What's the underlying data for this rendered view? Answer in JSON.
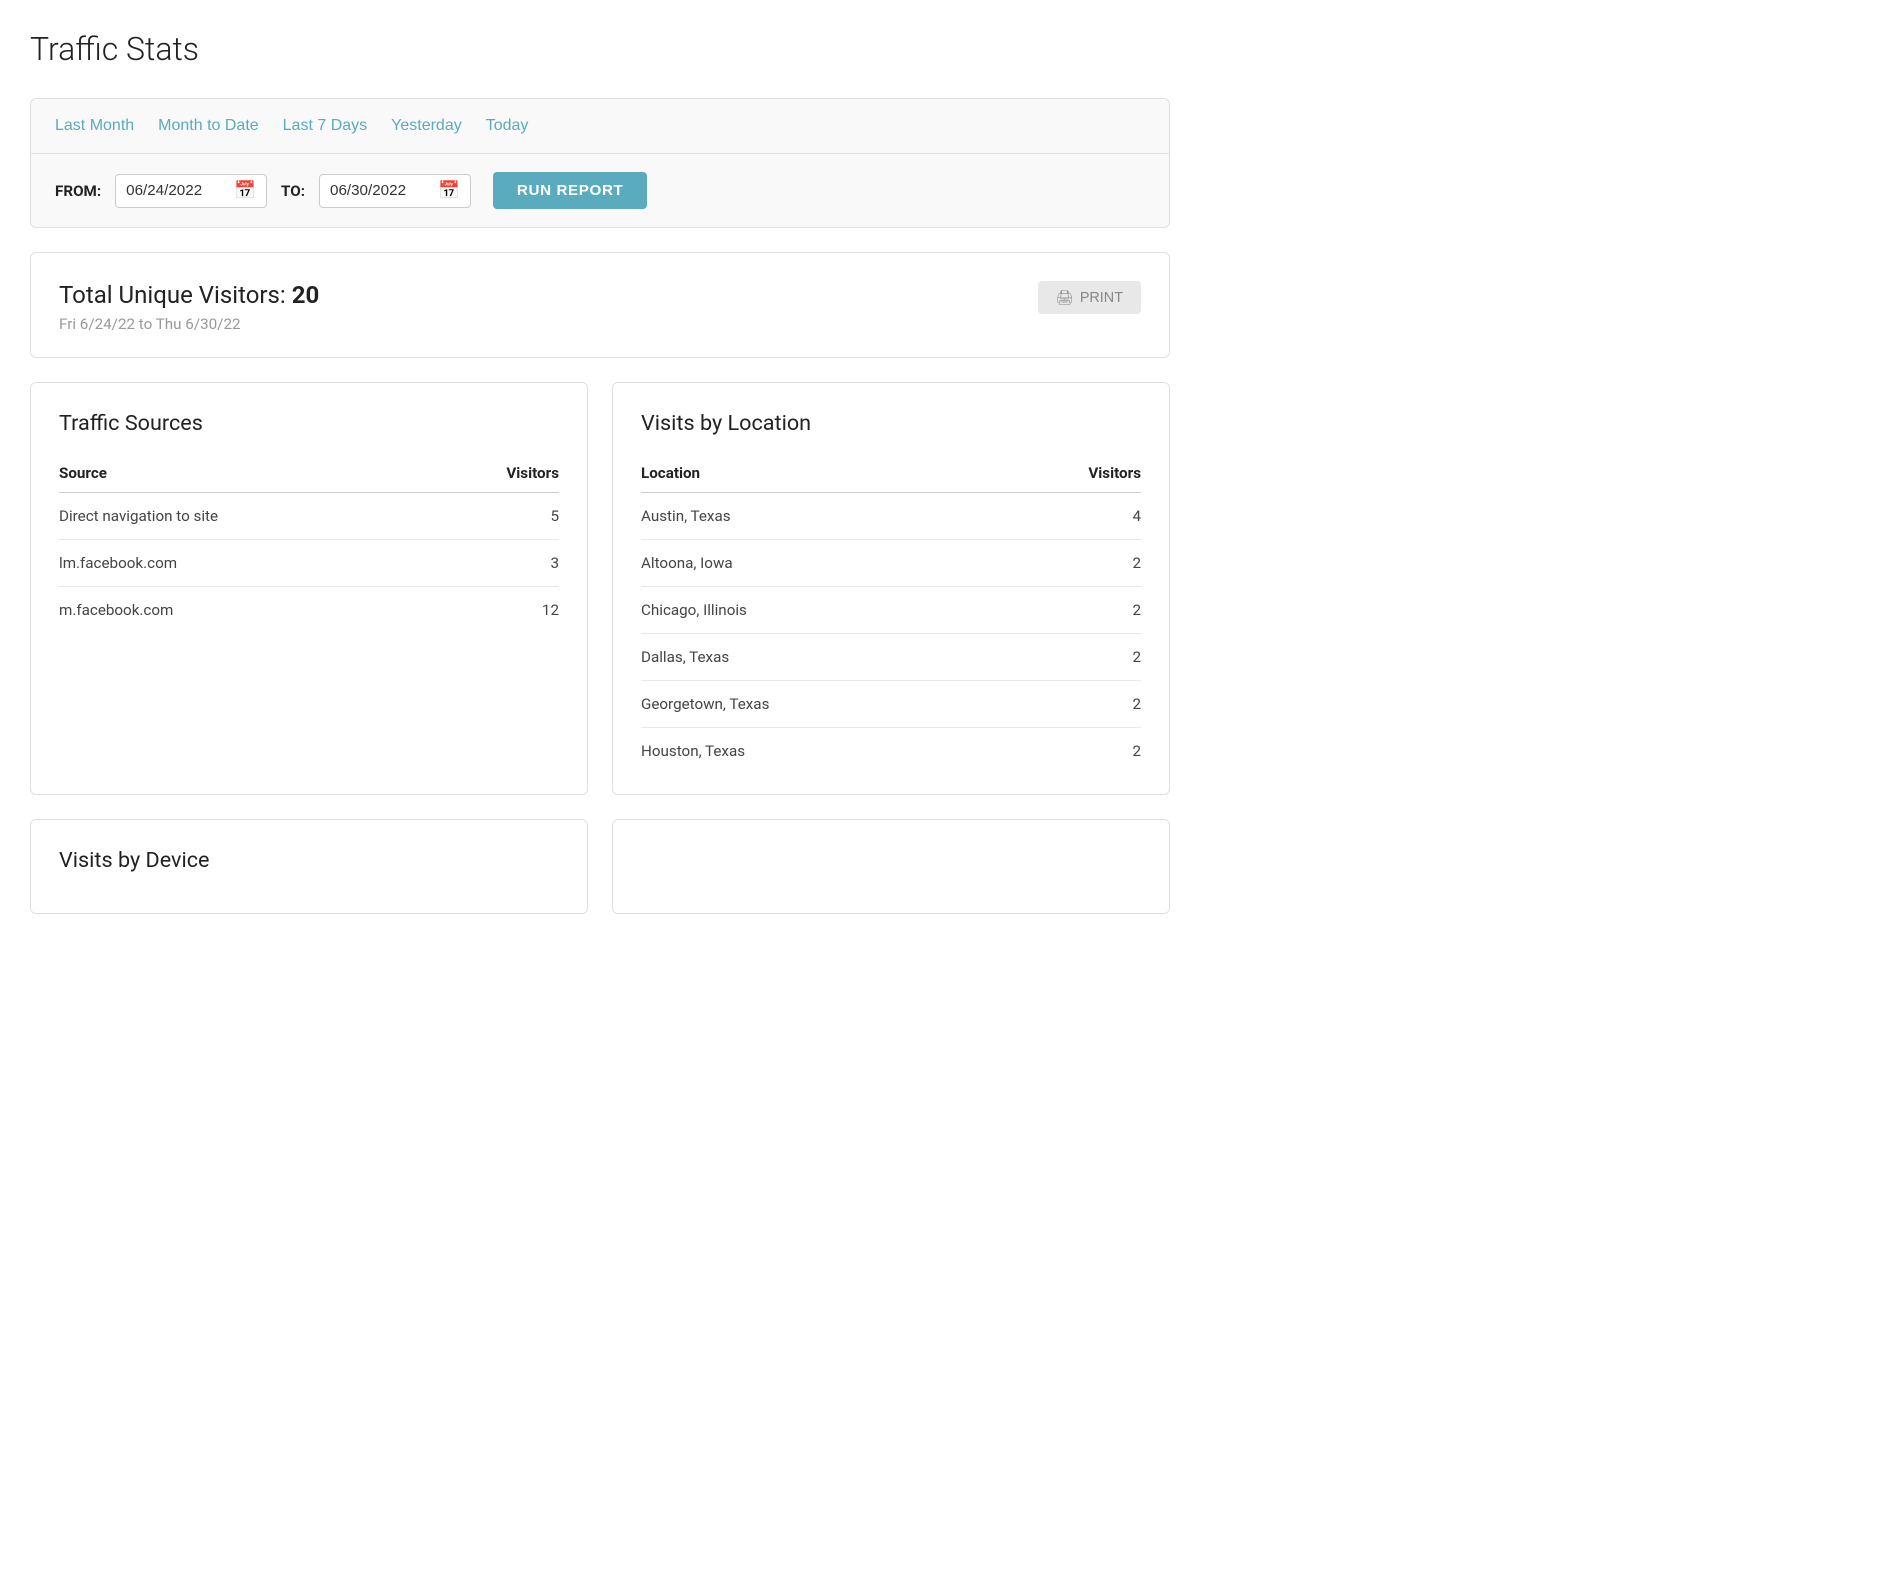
{
  "page": {
    "title": "Traffic Stats"
  },
  "quick_filters": {
    "items": [
      {
        "id": "last-month",
        "label": "Last Month"
      },
      {
        "id": "month-to-date",
        "label": "Month to Date"
      },
      {
        "id": "last-7-days",
        "label": "Last 7 Days"
      },
      {
        "id": "yesterday",
        "label": "Yesterday"
      },
      {
        "id": "today",
        "label": "Today"
      }
    ]
  },
  "date_filter": {
    "from_label": "FROM:",
    "to_label": "TO:",
    "from_value": "06/24/2022",
    "to_value": "06/30/2022",
    "run_button": "RUN REPORT"
  },
  "summary": {
    "label": "Total Unique Visitors:",
    "count": "20",
    "date_range": "Fri 6/24/22 to Thu 6/30/22",
    "print_button": "PRINT"
  },
  "traffic_sources": {
    "title": "Traffic Sources",
    "columns": [
      "Source",
      "Visitors"
    ],
    "rows": [
      {
        "source": "Direct navigation to site",
        "visitors": "5"
      },
      {
        "source": "lm.facebook.com",
        "visitors": "3"
      },
      {
        "source": "m.facebook.com",
        "visitors": "12"
      }
    ]
  },
  "visits_by_location": {
    "title": "Visits by Location",
    "columns": [
      "Location",
      "Visitors"
    ],
    "rows": [
      {
        "location": "Austin, Texas",
        "visitors": "4"
      },
      {
        "location": "Altoona, Iowa",
        "visitors": "2"
      },
      {
        "location": "Chicago, Illinois",
        "visitors": "2"
      },
      {
        "location": "Dallas, Texas",
        "visitors": "2"
      },
      {
        "location": "Georgetown, Texas",
        "visitors": "2"
      },
      {
        "location": "Houston, Texas",
        "visitors": "2"
      }
    ]
  },
  "visits_by_device": {
    "title": "Visits by Device"
  }
}
